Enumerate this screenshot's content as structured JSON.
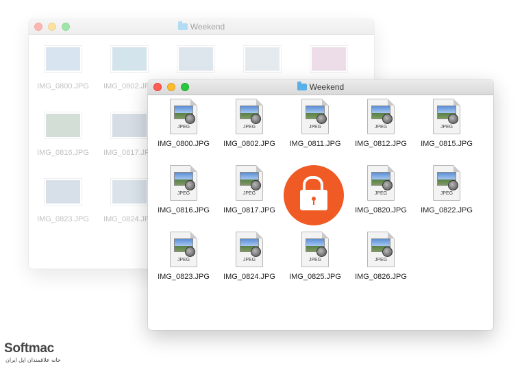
{
  "back_window": {
    "title": "Weekend",
    "items": [
      {
        "label": "IMG_0800.JPG",
        "color": "#a9c4dc"
      },
      {
        "label": "IMG_0802.JPG",
        "color": "#9fc5d6"
      },
      {
        "label": "",
        "color": "#b7c9d9"
      },
      {
        "label": "",
        "color": "#c6d2db"
      },
      {
        "label": "",
        "color": "#d7b6cd"
      },
      {
        "label": "IMG_0816.JPG",
        "color": "#9fb8a5"
      },
      {
        "label": "IMG_0817.JPG",
        "color": "#a6b4c4"
      },
      {
        "label": "IMG_0823.JPG",
        "color": "#a8b9cf"
      },
      {
        "label": "IMG_0824.JPG",
        "color": "#aec0d2"
      }
    ]
  },
  "front_window": {
    "title": "Weekend",
    "icon_type": "JPEG",
    "files": [
      "IMG_0800.JPG",
      "IMG_0802.JPG",
      "IMG_0811.JPG",
      "IMG_0812.JPG",
      "IMG_0815.JPG",
      "IMG_0816.JPG",
      "IMG_0817.JPG",
      "IMG_0820.JPG",
      "IMG_0822.JPG",
      "IMG_0823.JPG",
      "IMG_0824.JPG",
      "IMG_0825.JPG",
      "IMG_0826.JPG"
    ]
  },
  "lock_icon": {
    "color": "#f05a24",
    "name": "lock-icon"
  },
  "brand": {
    "name": "Softmac",
    "tagline": "خانه علاقمندان اپل ایران"
  }
}
